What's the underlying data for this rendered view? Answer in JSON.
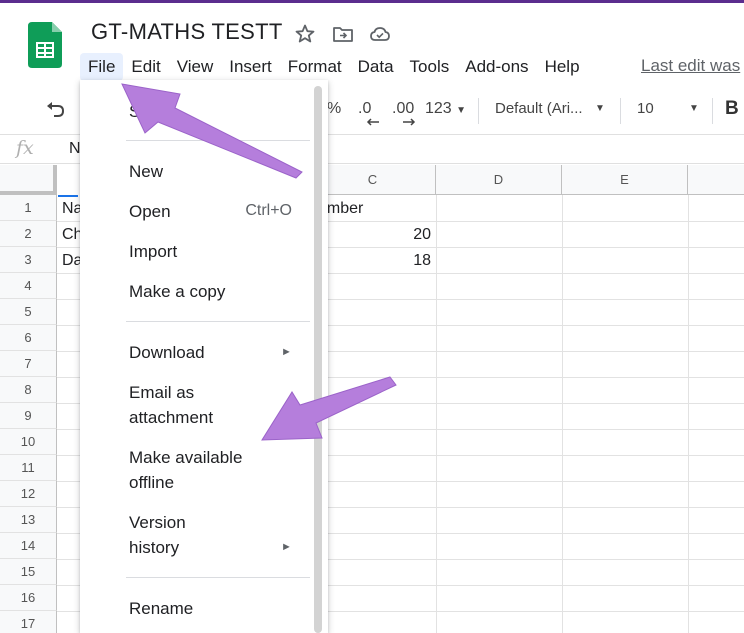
{
  "document": {
    "title": "GT-MATHS TESTT"
  },
  "menubar": {
    "items": [
      "File",
      "Edit",
      "View",
      "Insert",
      "Format",
      "Data",
      "Tools",
      "Add-ons",
      "Help"
    ],
    "last_edit": "Last edit was"
  },
  "toolbar": {
    "percent": "%",
    "dec_decrease": ".0",
    "dec_increase": ".00",
    "more_formats": "123",
    "font": "Default (Ari...",
    "font_size": "10",
    "bold": "B"
  },
  "formula_bar": {
    "fx": "fx",
    "content": "N"
  },
  "sheet": {
    "columns": [
      "C",
      "D",
      "E"
    ],
    "rows": [
      "1",
      "2",
      "3",
      "4",
      "5",
      "6",
      "7",
      "8",
      "9",
      "10",
      "11",
      "12",
      "13",
      "14",
      "15",
      "16",
      "17"
    ],
    "cells": {
      "a1": "Na",
      "a2": "Ch",
      "a3": "Da",
      "c1": "umber",
      "c2": "20",
      "c3": "18"
    }
  },
  "file_menu": {
    "partial_top": "S",
    "new": "New",
    "open": "Open",
    "open_shortcut": "Ctrl+O",
    "import": "Import",
    "make_copy": "Make a copy",
    "download": "Download",
    "email_l1": "Email as",
    "email_l2": "attachment",
    "offline_l1": "Make available",
    "offline_l2": "offline",
    "version_l1": "Version",
    "version_l2": "history",
    "rename": "Rename",
    "submenu_arrow": "►"
  },
  "colors": {
    "sheets_green": "#0f9d58",
    "annotation_purple": "#b57edc",
    "selection_blue": "#1a73e8",
    "frame": "#5b2d8e"
  }
}
